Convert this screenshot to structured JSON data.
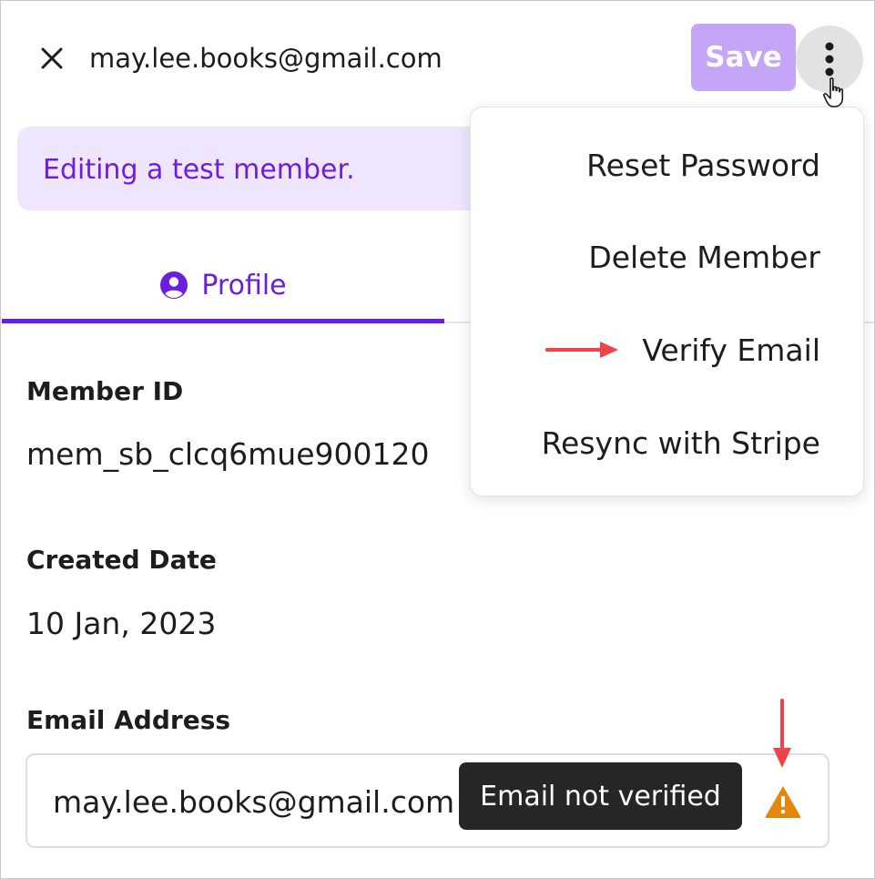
{
  "header": {
    "email": "may.lee.books@gmail.com",
    "save_label": "Save"
  },
  "banner": {
    "text": "Editing a test member."
  },
  "tabs": [
    {
      "label": "Profile",
      "icon": "user-circle-icon",
      "active": true
    }
  ],
  "fields": {
    "member_id": {
      "label": "Member ID",
      "value": "mem_sb_clcq6mue900120"
    },
    "created_date": {
      "label": "Created Date",
      "value": "10 Jan, 2023"
    },
    "email_address": {
      "label": "Email Address",
      "value": "may.lee.books@gmail.com"
    }
  },
  "tooltip": {
    "text": "Email not verified"
  },
  "menu": {
    "items": [
      {
        "label": "Reset Password"
      },
      {
        "label": "Delete Member"
      },
      {
        "label": "Verify Email"
      },
      {
        "label": "Resync with Stripe"
      }
    ]
  },
  "colors": {
    "accent": "#6b1fdc",
    "save_button": "#c4a5f7",
    "banner_bg": "#efe6fe",
    "annotation_arrow": "#f0424a",
    "warning": "#e3870e",
    "tooltip_bg": "#262626"
  }
}
